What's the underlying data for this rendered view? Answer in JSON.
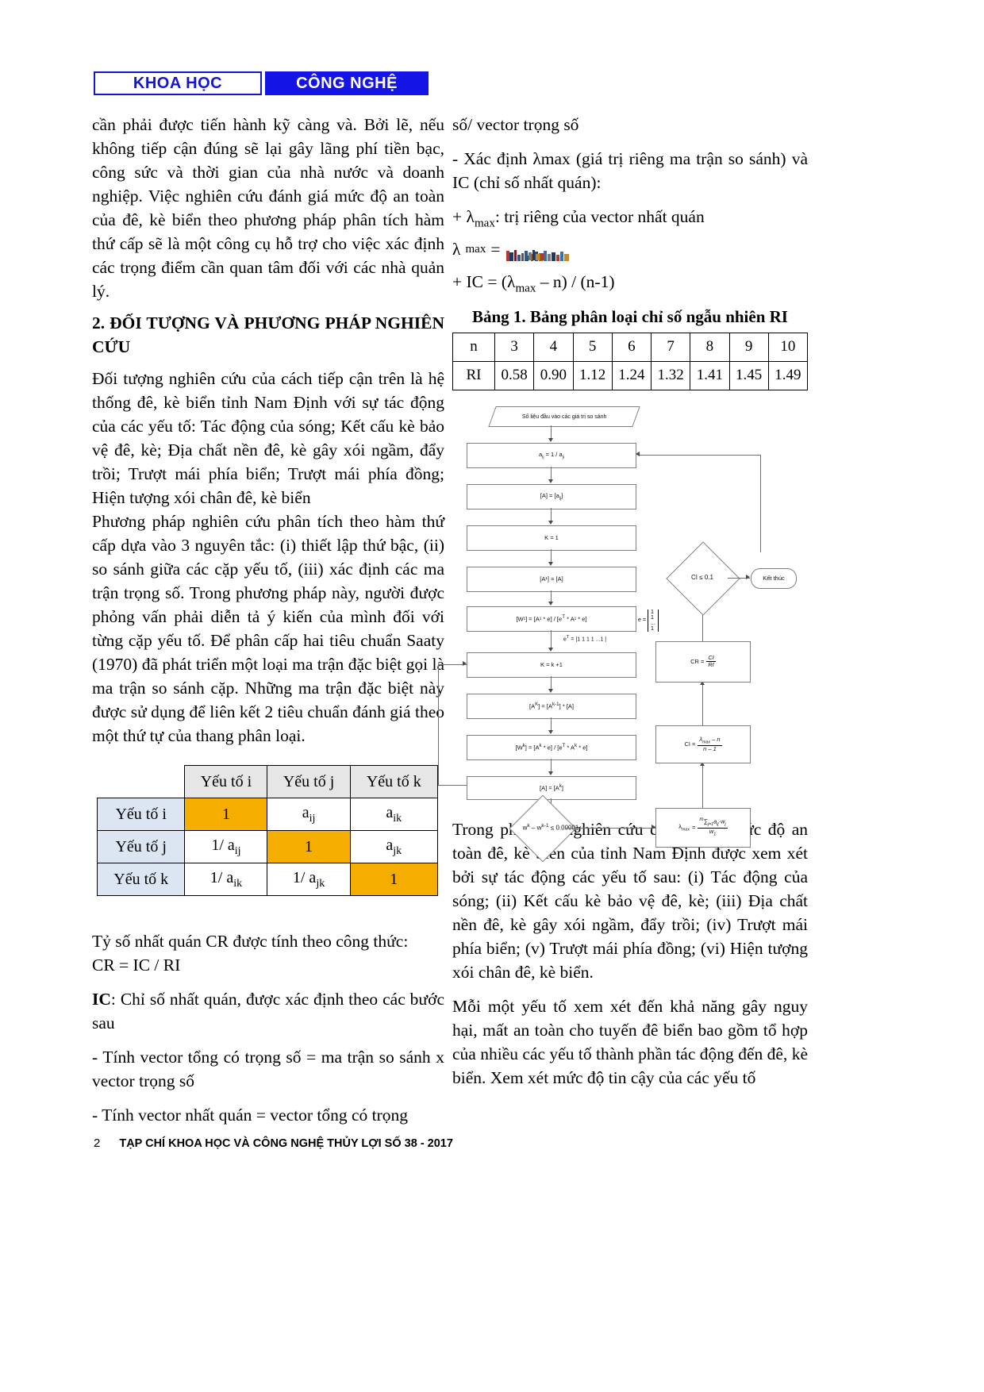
{
  "header": {
    "left_label": "KHOA HỌC",
    "right_label": "CÔNG NGHỆ"
  },
  "left_column": {
    "para1": "cần phải được tiến hành kỹ càng và. Bởi lẽ, nếu không tiếp cận đúng sẽ lại gây lãng phí tiền bạc, công sức và thời gian của nhà nước và doanh nghiệp. Việc nghiên cứu đánh giá mức độ an toàn của đê, kè biển theo phương pháp phân tích hàm thứ cấp sẽ là một công cụ hỗ trợ cho việc xác định các trọng điểm cần quan tâm đối với các nhà quản lý.",
    "section_heading": "2. ĐỐI TƯỢNG VÀ PHƯƠNG PHÁP NGHIÊN CỨU",
    "para2": "Đối tượng nghiên cứu của cách tiếp cận trên là hệ thống đê, kè biển tỉnh Nam Định với sự tác động của các yếu tố: Tác động của sóng; Kết cấu kè bảo vệ đê, kè; Địa chất nền đê, kè gây xói ngầm, đẩy trồi; Trượt mái phía biển; Trượt mái phía đồng; Hiện tượng xói chân đê, kè biển",
    "para3": "Phương pháp nghiên cứu phân tích theo hàm thứ cấp dựa vào 3 nguyên tắc: (i) thiết lập thứ bậc, (ii) so sánh giữa các cặp yếu tố, (iii) xác định các ma trận trọng số. Trong phương pháp này, người được phỏng vấn phải diễn tả ý kiến của mình đối với từng cặp yếu tố. Để phân cấp hai tiêu chuẩn Saaty (1970) đã phát triển một loại ma trận đặc biệt gọi là ma trận so sánh cặp. Những ma trận đặc  biệt này được sử dụng để liên kết 2 tiêu chuẩn đánh giá theo một thứ tự của thang phân loại.",
    "para4_line1": "Tỷ số nhất quán CR được tính theo công thức:",
    "para4_line2": "CR = IC / RI",
    "para5_bold": "IC",
    "para5_rest": ": Chỉ số nhất quán, được xác định theo các bước sau",
    "para6": "- Tính vector tổng có trọng số = ma trận so sánh x vector trọng số",
    "para7": "- Tính vector nhất quán = vector tổng có trọng"
  },
  "matrix_table": {
    "col_headers": [
      "",
      "Yếu tố i",
      "Yếu tố j",
      "Yếu tố k"
    ],
    "rows": [
      {
        "label": "Yếu tố i",
        "cells": [
          "1",
          "a_ij",
          "a_ik"
        ],
        "diag_index": 0
      },
      {
        "label": "Yếu tố j",
        "cells": [
          "1/ a_ij",
          "1",
          "a_jk"
        ],
        "diag_index": 1
      },
      {
        "label": "Yếu tố k",
        "cells": [
          "1/ a_ik",
          "1/ a_jk",
          "1"
        ],
        "diag_index": 2
      }
    ],
    "cell_text": {
      "one": "1",
      "a_ij": "a",
      "a_ij_sub": "ij",
      "a_ik": "a",
      "a_ik_sub": "ik",
      "a_jk": "a",
      "a_jk_sub": "jk",
      "inv_prefix": "1/ "
    },
    "colors": {
      "diagonal": "#f5ad00",
      "row_header": "#dce6f2",
      "col_header": "#e6e6e6"
    }
  },
  "right_column": {
    "para1": "số/ vector trọng số",
    "para2": "- Xác định λmax (giá trị riêng ma trận so sánh) và IC (chỉ số nhất quán):",
    "para3_plus": "+ λ",
    "para3_sub": "max",
    "para3_rest": ": trị riêng của vector nhất quán",
    "lambda_label": "λ",
    "lambda_sub": "max",
    "lambda_eq": "=",
    "ic_formula_plus": "+ IC = (λ",
    "ic_formula_sub": "max",
    "ic_formula_rest": " – n) / (n-1)",
    "para_after_flow1": "Trong phạm vi nghiên cứu của đề tài, mức độ an toàn đê, kè biển của tỉnh Nam Định được xem xét bởi sự tác động các yếu tố sau: (i) Tác động của sóng; (ii) Kết cấu kè bảo vệ đê, kè; (iii) Địa chất nền đê, kè gây xói ngầm, đẩy trồi; (iv) Trượt mái phía biển; (v) Trượt mái phía đồng; (vi) Hiện tượng xói chân đê, kè biển.",
    "para_after_flow2": "Mỗi một yếu tố xem xét đến khả năng gây nguy hại, mất an toàn cho tuyến đê biển bao gồm tổ hợp của nhiều các yếu tố thành phần tác động đến đê, kè biển. Xem xét mức độ tin cậy của các yếu tố"
  },
  "bang1": {
    "title": "Bảng 1. Bảng phân loại chỉ số ngẫu nhiên RI",
    "row_n_label": "n",
    "n_values": [
      "3",
      "4",
      "5",
      "6",
      "7",
      "8",
      "9",
      "10"
    ],
    "row_ri_label": "RI",
    "ri_values": [
      "0.58",
      "0.90",
      "1.12",
      "1.24",
      "1.32",
      "1.41",
      "1.45",
      "1.49"
    ]
  },
  "flowchart": {
    "start": "Số liệu đầu vào các giá trị so sánh",
    "b1": "a",
    "b1_sub1": "ij",
    "b1_mid": " = 1 / a",
    "b1_sub2": "ji",
    "b2": "[A] = [a",
    "b2_sub": "ij",
    "b2_end": "]",
    "b3": "K = 1",
    "b4": "[A¹] = [A]",
    "b5": "[W¹] = [A¹ * e] / [e",
    "b5_sup": "T",
    "b5_end": " * A¹ * e]",
    "e_label": "e =",
    "e_vector": [
      "1",
      "1",
      "...",
      "1"
    ],
    "et_label": "e",
    "et_sup": "T",
    "et_rest": " = |1 1 1 1 ...1 |",
    "b6": "K = k +1",
    "b7": "[A",
    "b7_sup": "K",
    "b7_mid": "] = [A",
    "b7_sup2": "k-1",
    "b7_end": "] * [A]",
    "b8": "[W",
    "b8_sup": "k",
    "b8_mid": "] = [A",
    "b8_sup2": "k",
    "b8_end": " * e] / [e",
    "b8_sup3": "T",
    "b8_end2": " * A",
    "b8_sup4": "k",
    "b8_end3": " * e]",
    "b9": "[A] = [A",
    "b9_sup": "k",
    "b9_end": "]",
    "dec_bottom": "w",
    "dec_bottom_sup1": "k",
    "dec_bottom_mid": " – w",
    "dec_bottom_sup2": "k-1",
    "dec_bottom_end": " ≤ 0.00001",
    "lambda_box_label": "λ",
    "lambda_box_sub": "max",
    "lambda_box_eq": "=",
    "lambda_box_num": "∑",
    "lambda_box_num_sub": "j=1",
    "lambda_box_num_sup": "m",
    "lambda_box_num_rest": "a",
    "lambda_box_num_rest_sub": "ij",
    "lambda_box_num_rest2": "·w",
    "lambda_box_num_rest2_sub": "j",
    "lambda_box_den": "w",
    "lambda_box_den_sub": "1",
    "ci_box_label": "CI =",
    "ci_num": "λ",
    "ci_num_sub": "max",
    "ci_num_rest": " – n",
    "ci_den": "n – 1",
    "cr_box_label": "CR =",
    "cr_num": "CI",
    "cr_den": "RI",
    "decision": "CI ≤ 0.1",
    "end": "Kết thúc"
  },
  "footer": {
    "page_number": "2",
    "journal": "TẠP CHÍ KHOA HỌC VÀ CÔNG NGHỆ THỦY LỢI SỐ 38 - 2017"
  }
}
